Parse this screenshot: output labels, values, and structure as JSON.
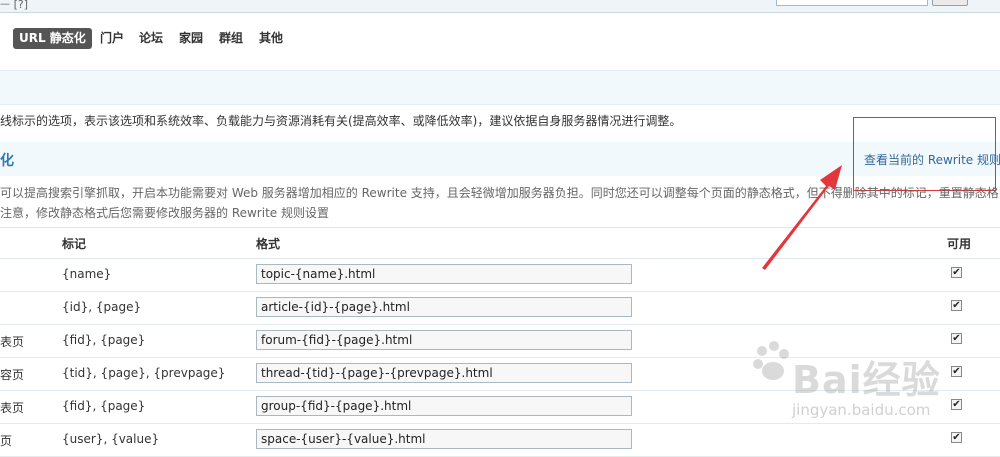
{
  "topbar": {
    "crumb": "ᅳ [?]"
  },
  "tabs": [
    {
      "label": "URL 静态化",
      "active": true
    },
    {
      "label": "门户"
    },
    {
      "label": "论坛"
    },
    {
      "label": "家园"
    },
    {
      "label": "群组"
    },
    {
      "label": "其他"
    }
  ],
  "notice": "线标示的选项，表示该选项和系统效率、负载能力与资源消耗有关(提高效率、或降低效率)，建议依据自身服务器情况进行调整。",
  "section": {
    "title": "化",
    "rewrite_link": "查看当前的 Rewrite 规则",
    "desc_line1": "可以提高搜索引擎抓取，开启本功能需要对 Web 服务器增加相应的 Rewrite 支持，且会轻微增加服务器负担。同时您还可以调整每个页面的静态格式，但不得删除其中的标记，重置静态格",
    "desc_line2": "注意，修改静态格式后您需要修改服务器的 Rewrite 规则设置"
  },
  "table": {
    "headers": {
      "mark": "标记",
      "format": "格式",
      "enabled": "可用"
    },
    "rows": [
      {
        "label": "",
        "mark": "{name}",
        "format": "topic-{name}.html",
        "checked": "✔"
      },
      {
        "label": "",
        "mark": "{id}, {page}",
        "format": "article-{id}-{page}.html",
        "checked": "✔"
      },
      {
        "label": "表页",
        "mark": "{fid}, {page}",
        "format": "forum-{fid}-{page}.html",
        "checked": "✔"
      },
      {
        "label": "容页",
        "mark": "{tid}, {page}, {prevpage}",
        "format": "thread-{tid}-{page}-{prevpage}.html",
        "checked": "✔"
      },
      {
        "label": "表页",
        "mark": "{fid}, {page}",
        "format": "group-{fid}-{page}.html",
        "checked": "✔"
      },
      {
        "label": "页",
        "mark": "{user}, {value}",
        "format": "space-{user}-{value}.html",
        "checked": "✔"
      }
    ]
  },
  "watermark": {
    "brand": "Bai经验",
    "url": "jingyan.baidu.com"
  },
  "colors": {
    "accent": "#2b7ab0",
    "annotation": "#d9363a",
    "tab_active": "#555555"
  }
}
